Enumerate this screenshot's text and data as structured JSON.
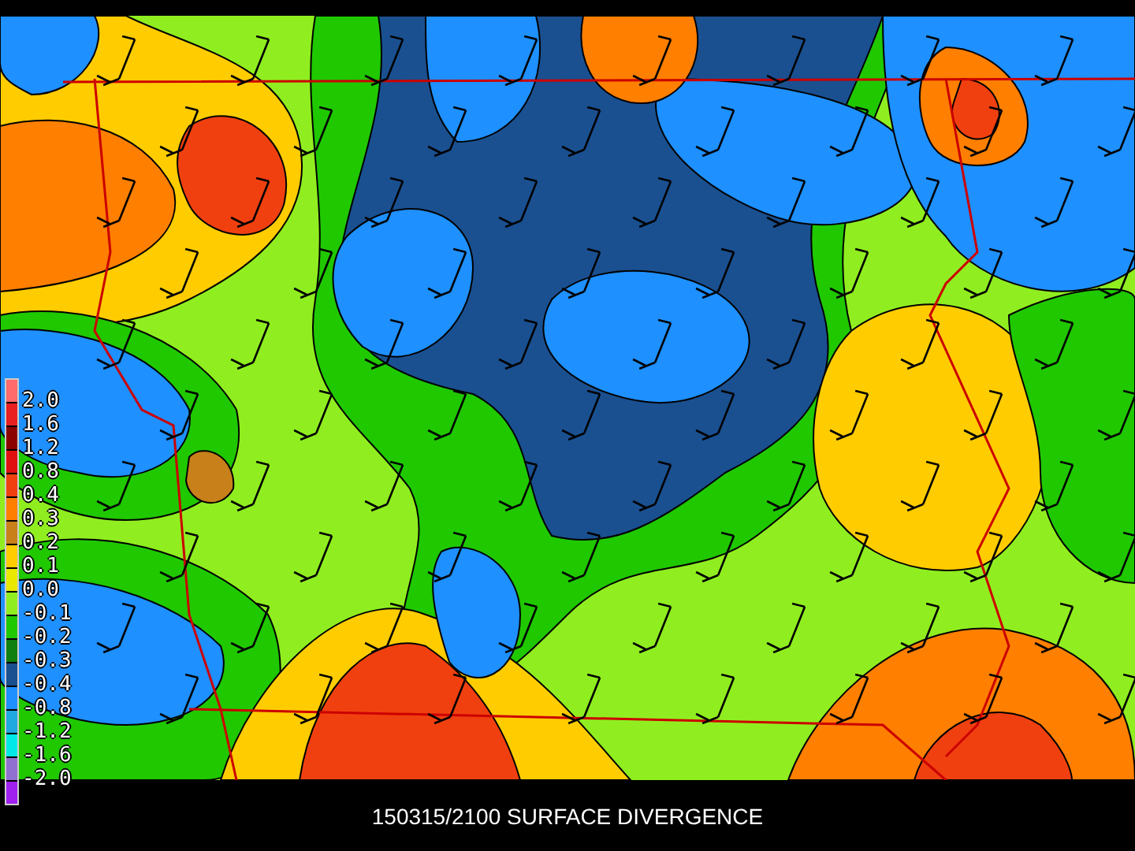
{
  "legend": {
    "swatches": [
      {
        "color": "#ff6a6a"
      },
      {
        "color": "#e82020"
      },
      {
        "color": "#8b0000"
      },
      {
        "color": "#e01010"
      },
      {
        "color": "#f04010"
      },
      {
        "color": "#ff7f00"
      },
      {
        "color": "#c8801a"
      },
      {
        "color": "#ffcc00"
      },
      {
        "color": "#e8e800"
      },
      {
        "color": "#90ee20"
      },
      {
        "color": "#20c800"
      },
      {
        "color": "#108010"
      },
      {
        "color": "#1a5090"
      },
      {
        "color": "#1e90ff"
      },
      {
        "color": "#20a8e0"
      },
      {
        "color": "#00e8e8"
      },
      {
        "color": "#9070d0"
      },
      {
        "color": "#a020f0"
      }
    ],
    "labels": [
      "2.0",
      "1.6",
      "1.2",
      "0.8",
      "0.4",
      "0.3",
      "0.2",
      "0.1",
      "0.0",
      "-0.1",
      "-0.2",
      "-0.3",
      "-0.4",
      "-0.8",
      "-1.2",
      "-1.6",
      "-2.0"
    ]
  },
  "title": "150315/2100 SURFACE DIVERGENCE"
}
